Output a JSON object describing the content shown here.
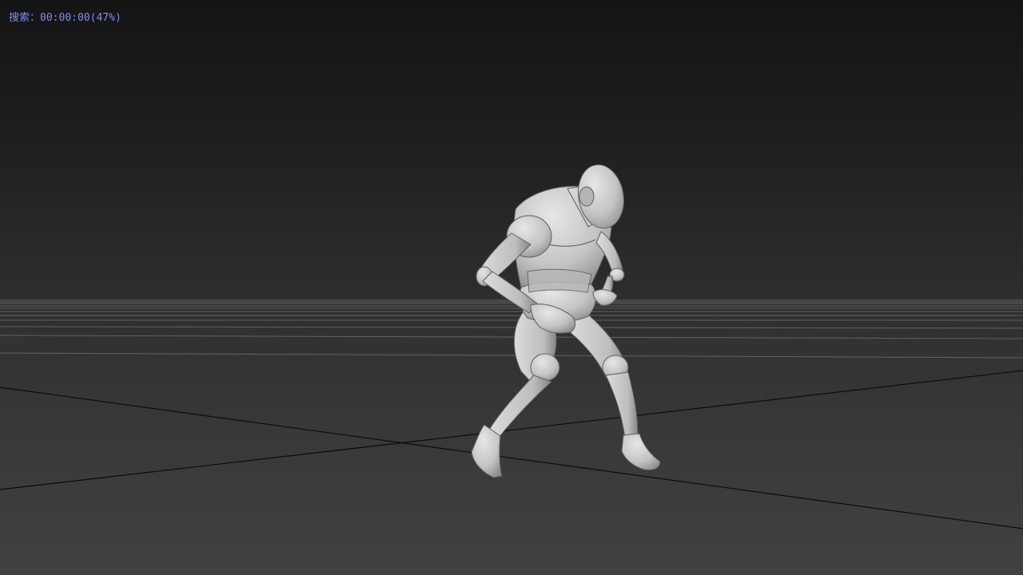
{
  "viewport": {
    "overlay": {
      "label": "搜索",
      "separator": "：",
      "timecode": "00:00:00",
      "progress_text": "(47%)"
    },
    "colors": {
      "overlay_text": "#7f8fe6",
      "background_top": "#141414",
      "background_bottom": "#414141",
      "grid_line": "#8a8a8a",
      "axis_line": "#0b0b0b",
      "model_light": "#d9d9d9",
      "model_mid": "#a9a9a9",
      "model_shadow": "#6e6e6e"
    },
    "model": {
      "name": "mannequin-model"
    }
  }
}
